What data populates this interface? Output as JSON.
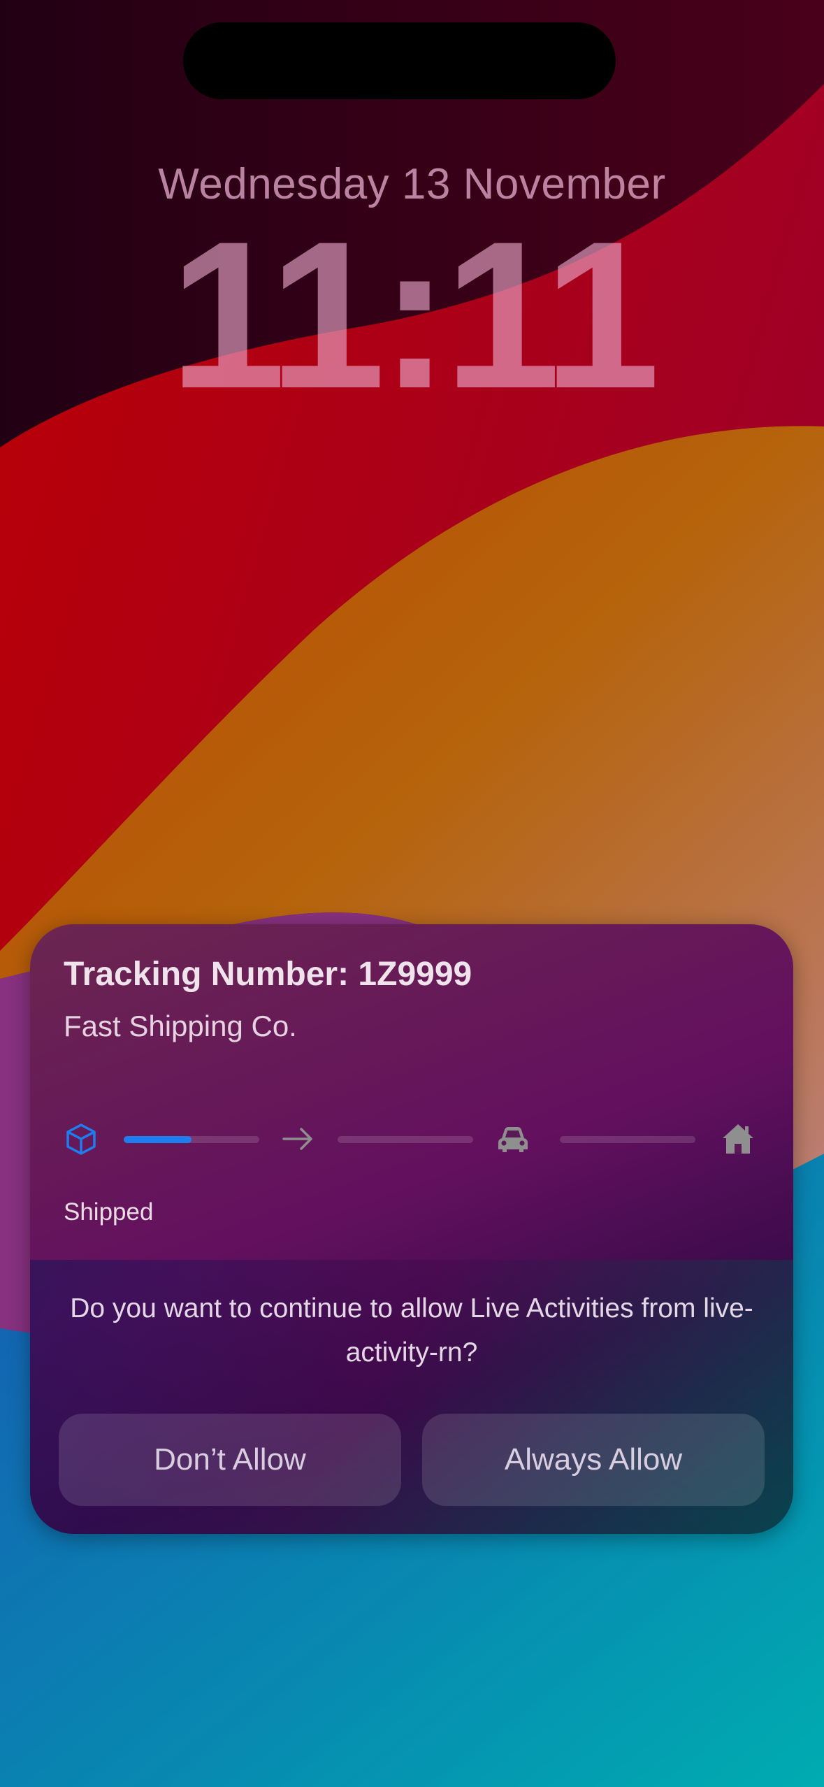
{
  "lock_screen": {
    "date": "Wednesday 13 November",
    "time": "11:11"
  },
  "live_activity": {
    "title": "Tracking Number: 1Z9999",
    "subtitle": "Fast Shipping Co.",
    "status": "Shipped",
    "progress": {
      "steps": [
        "box-icon",
        "arrow-right-icon",
        "car-icon",
        "house-icon"
      ],
      "segment_fill": [
        0.5,
        0,
        0
      ],
      "active_color": "#1e7ef0",
      "inactive_color": "#8f8f8f"
    }
  },
  "permission_prompt": {
    "message": "Do you want to continue to allow Live Activities from live-activity-rn?",
    "deny_label": "Don’t Allow",
    "allow_label": "Always Allow"
  }
}
